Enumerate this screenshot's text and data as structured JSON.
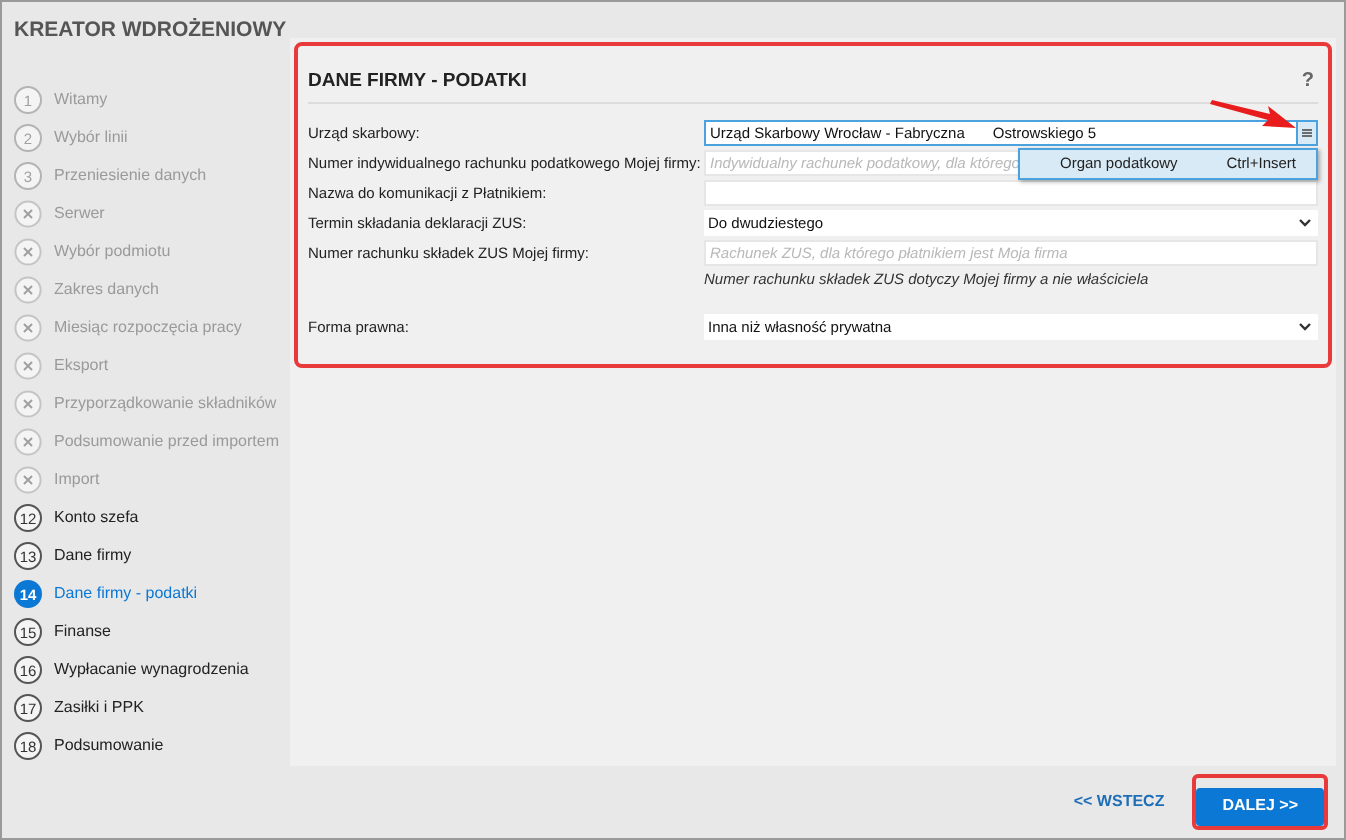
{
  "sidebar": {
    "title": "KREATOR WDROŻENIOWY",
    "steps": [
      {
        "number": "1",
        "label": "Witamy",
        "kind": "done",
        "selected": false
      },
      {
        "number": "2",
        "label": "Wybór linii",
        "kind": "done",
        "selected": false
      },
      {
        "number": "3",
        "label": "Przeniesienie danych",
        "kind": "done",
        "selected": false
      },
      {
        "label": "Serwer",
        "kind": "skipped",
        "selected": false
      },
      {
        "label": "Wybór podmiotu",
        "kind": "skipped",
        "selected": false
      },
      {
        "label": "Zakres danych",
        "kind": "skipped",
        "selected": false
      },
      {
        "label": "Miesiąc rozpoczęcia pracy",
        "kind": "skipped",
        "selected": false
      },
      {
        "label": "Eksport",
        "kind": "skipped",
        "selected": false
      },
      {
        "label": "Przyporządkowanie składników",
        "kind": "skipped",
        "selected": false
      },
      {
        "label": "Podsumowanie przed importem",
        "kind": "skipped",
        "selected": false
      },
      {
        "label": "Import",
        "kind": "skipped",
        "selected": false
      },
      {
        "number": "12",
        "label": "Konto szefa",
        "kind": "pending",
        "selected": false
      },
      {
        "number": "13",
        "label": "Dane firmy",
        "kind": "pending",
        "selected": false
      },
      {
        "number": "14",
        "label": "Dane firmy - podatki",
        "kind": "pending",
        "selected": true
      },
      {
        "number": "15",
        "label": "Finanse",
        "kind": "pending",
        "selected": false
      },
      {
        "number": "16",
        "label": "Wypłacanie wynagrodzenia",
        "kind": "pending",
        "selected": false
      },
      {
        "number": "17",
        "label": "Zasiłki i PPK",
        "kind": "pending",
        "selected": false
      },
      {
        "number": "18",
        "label": "Podsumowanie",
        "kind": "pending",
        "selected": false
      }
    ]
  },
  "form": {
    "title": "DANE FIRMY - PODATKI",
    "help": "?",
    "fields": [
      {
        "label": "Urząd skarbowy:",
        "kind": "lookup",
        "value": "Urząd Skarbowy Wrocław - Fabryczna",
        "value_2": "Ostrowskiego 5",
        "menu": {
          "item": "Organ podatkowy",
          "shortcut": "Ctrl+Insert"
        }
      },
      {
        "label": "Numer indywidualnego rachunku podatkowego Mojej firmy:",
        "kind": "text",
        "placeholder": "Indywidualny rachunek podatkowy, dla którego"
      },
      {
        "label": "Nazwa do komunikacji z Płatnikiem:",
        "kind": "text"
      },
      {
        "label": "Termin składania deklaracji ZUS:",
        "kind": "select",
        "value": "Do dwudziestego"
      },
      {
        "label": "Numer rachunku składek ZUS Mojej firmy:",
        "kind": "text",
        "placeholder": "Rachunek ZUS, dla którego płatnikiem jest Moja firma",
        "note": "Numer rachunku składek ZUS dotyczy Mojej firmy a nie właściciela"
      },
      {
        "label": "Forma prawna:",
        "kind": "select",
        "value": "Inna niż własność prywatna"
      }
    ]
  },
  "footer": {
    "back": "<< WSTECZ",
    "next": "DALEJ >>"
  }
}
